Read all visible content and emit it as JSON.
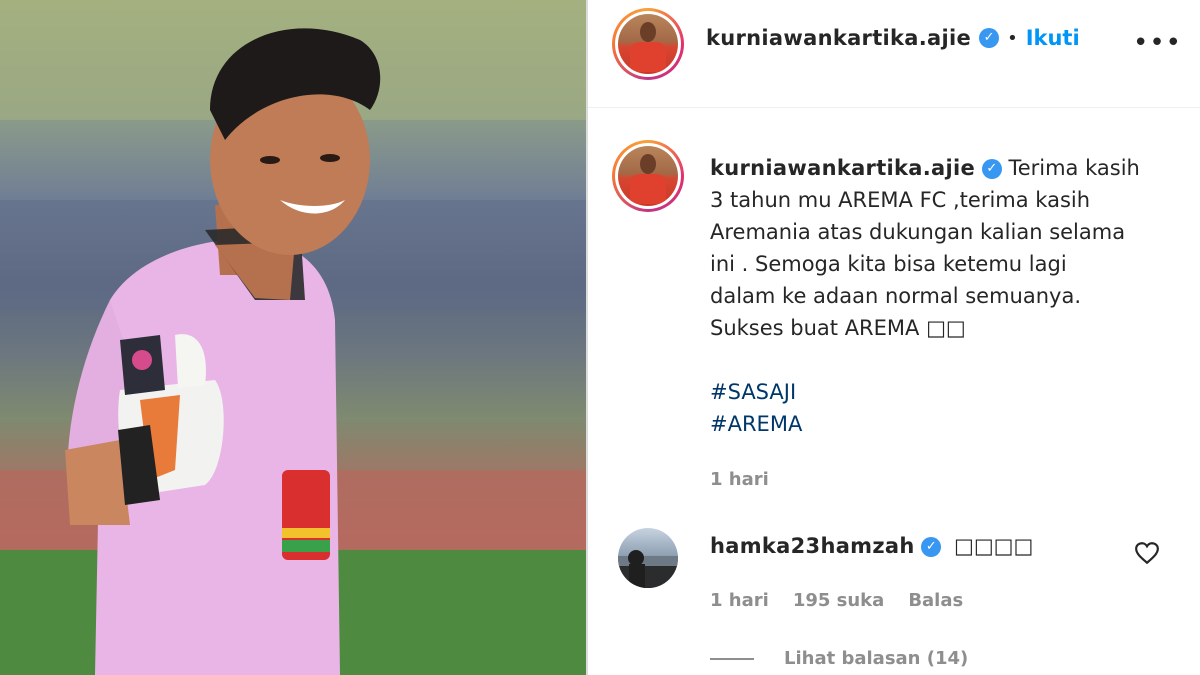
{
  "post": {
    "username": "kurniawankartika.ajie",
    "verified_mark": "✓",
    "separator": "•",
    "follow_label": "Ikuti",
    "more_label": "•••"
  },
  "caption": {
    "username": "kurniawankartika.ajie",
    "lines": [
      "Terima kasih",
      "3 tahun mu AREMA FC ,terima kasih",
      "Aremania atas dukungan kalian selama",
      "ini . Semoga kita bisa ketemu lagi",
      "dalam ke adaan normal semuanya.",
      "Sukses buat AREMA □□"
    ],
    "hashtags": [
      "#SASAJI",
      "#AREMA"
    ],
    "time": "1 hari"
  },
  "comment": {
    "username": "hamka23hamzah",
    "text": "□□□□",
    "time": "1 hari",
    "likes": "195 suka",
    "reply_label": "Balas",
    "view_replies": "Lihat balasan (14)"
  },
  "icons": {
    "verified": "verified-badge-icon",
    "heart": "heart-icon",
    "more": "more-options-icon"
  },
  "colors": {
    "accent_blue": "#0095f6",
    "verified_blue": "#3897f0",
    "hashtag": "#00376b",
    "muted": "#8e8e8e"
  }
}
